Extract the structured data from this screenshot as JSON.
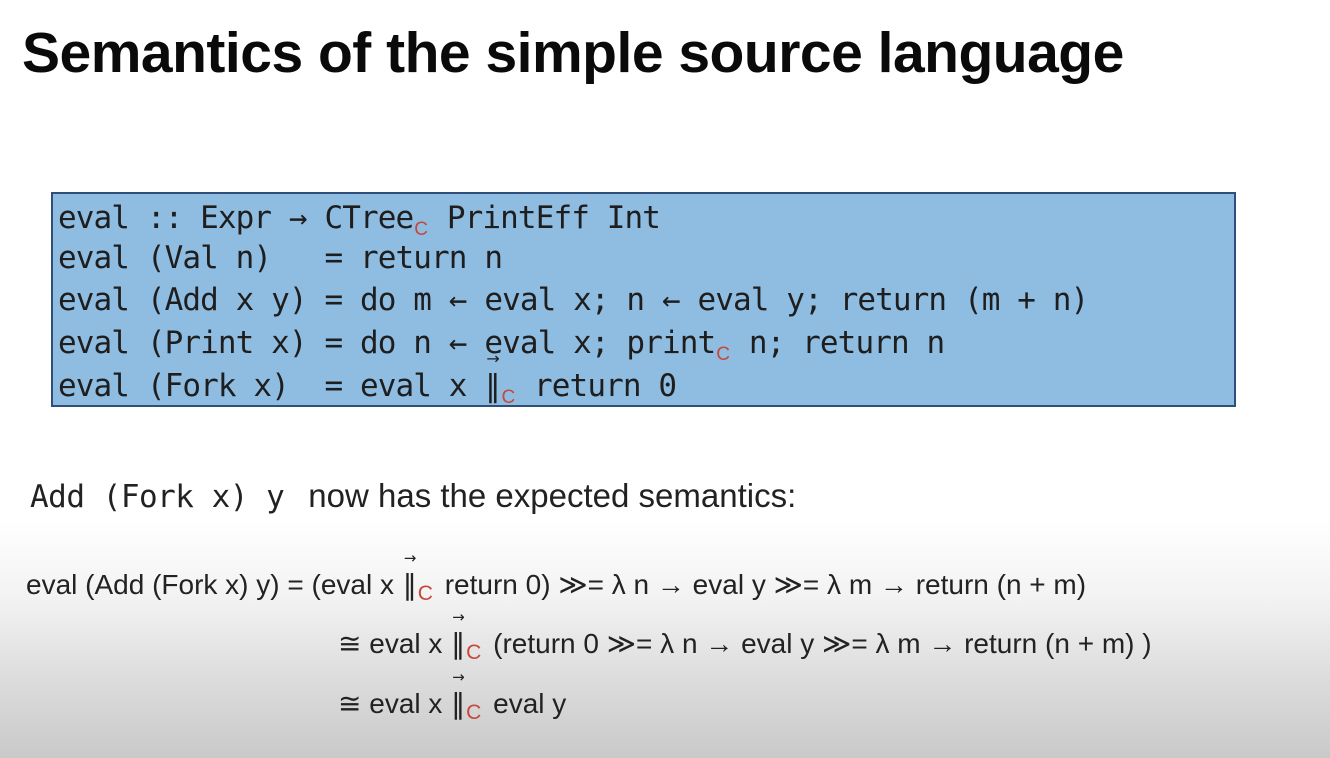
{
  "slide": {
    "title": "Semantics of the simple source language"
  },
  "code": {
    "line0_a": "eval :: Expr → CTree",
    "line0_sub": "C",
    "line0_b": " PrintEff Int",
    "line1": "eval (Val n)   = return n",
    "line2": "eval (Add x y) = do m ← eval x; n ← eval y; return (m + n)",
    "line3_a": "eval (Print x) = do n ← eval x; print",
    "line3_sub": "C",
    "line3_b": " n; return n",
    "line4_a": "eval (Fork x)  = eval x ",
    "line4_op": "‖",
    "line4_arrow": "→",
    "line4_sub": "C",
    "line4_b": " return 0"
  },
  "statement": {
    "code": "Add (Fork x) y",
    "text": "now has the expected semantics:"
  },
  "equations": {
    "e0_a": "eval (Add (Fork x) y) = (eval x ",
    "e0_sub": "C",
    "e0_b": " return 0) ≫= λ n → eval y ≫= λ m → return (n + m)",
    "e1_a": "≅ eval x ",
    "e1_sub": "C",
    "e1_b": " (return 0 ≫= λ n → eval y ≫= λ m → return (n + m) )",
    "e2_a": "≅ eval x ",
    "e2_sub": "C",
    "e2_b": " eval y",
    "par_op": "‖",
    "par_arrow": "→"
  }
}
